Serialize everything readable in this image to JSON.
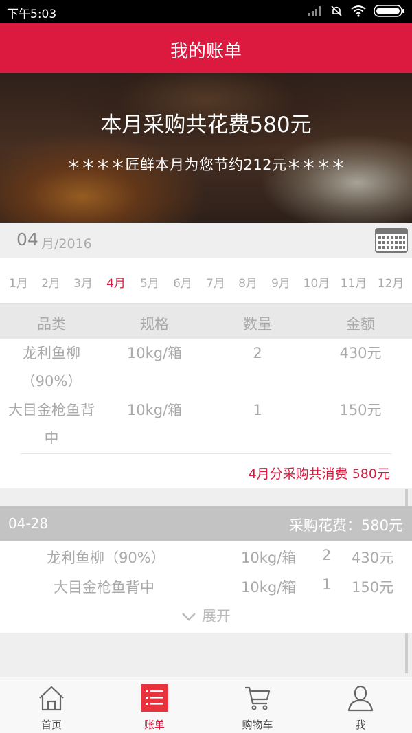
{
  "status_bar": {
    "time": "下午5:03"
  },
  "header": {
    "title": "我的账单"
  },
  "banner": {
    "title": "本月采购共花费580元",
    "subtitle": "＊＊＊＊匠鲜本月为您节约212元＊＊＊＊"
  },
  "date_bar": {
    "month": "04",
    "rest": "月/2016"
  },
  "months": [
    "1月",
    "2月",
    "3月",
    "4月",
    "5月",
    "6月",
    "7月",
    "8月",
    "9月",
    "10月",
    "11月",
    "12月"
  ],
  "selected_month": "4月",
  "summary": {
    "headers": [
      "品类",
      "规格",
      "数量",
      "金额"
    ],
    "rows": [
      {
        "name_line1": "龙利鱼柳",
        "name_line2": "（90%）",
        "spec": "10kg/箱",
        "qty": "2",
        "amount": "430元"
      },
      {
        "name_line1": "大目金枪鱼背",
        "name_line2": "中",
        "spec": "10kg/箱",
        "qty": "1",
        "amount": "150元"
      }
    ],
    "total": "4月分采购共消费 580元"
  },
  "order": {
    "date": "04-28",
    "cost": "采购花费：580元",
    "items": [
      {
        "name": "龙利鱼柳（90%）",
        "spec": "10kg/箱",
        "qty": "2",
        "amount": "430元"
      },
      {
        "name": "大目金枪鱼背中",
        "spec": "10kg/箱",
        "qty": "1",
        "amount": "150元"
      }
    ],
    "expand_label": "展开"
  },
  "nav": [
    {
      "label": "首页",
      "icon": "home-icon"
    },
    {
      "label": "账单",
      "icon": "bill-list-icon"
    },
    {
      "label": "购物车",
      "icon": "cart-icon"
    },
    {
      "label": "我",
      "icon": "user-icon"
    }
  ],
  "colors": {
    "accent": "#dc1a40",
    "muted_text": "#aaaaaa",
    "order_header": "#c3c3c3"
  }
}
